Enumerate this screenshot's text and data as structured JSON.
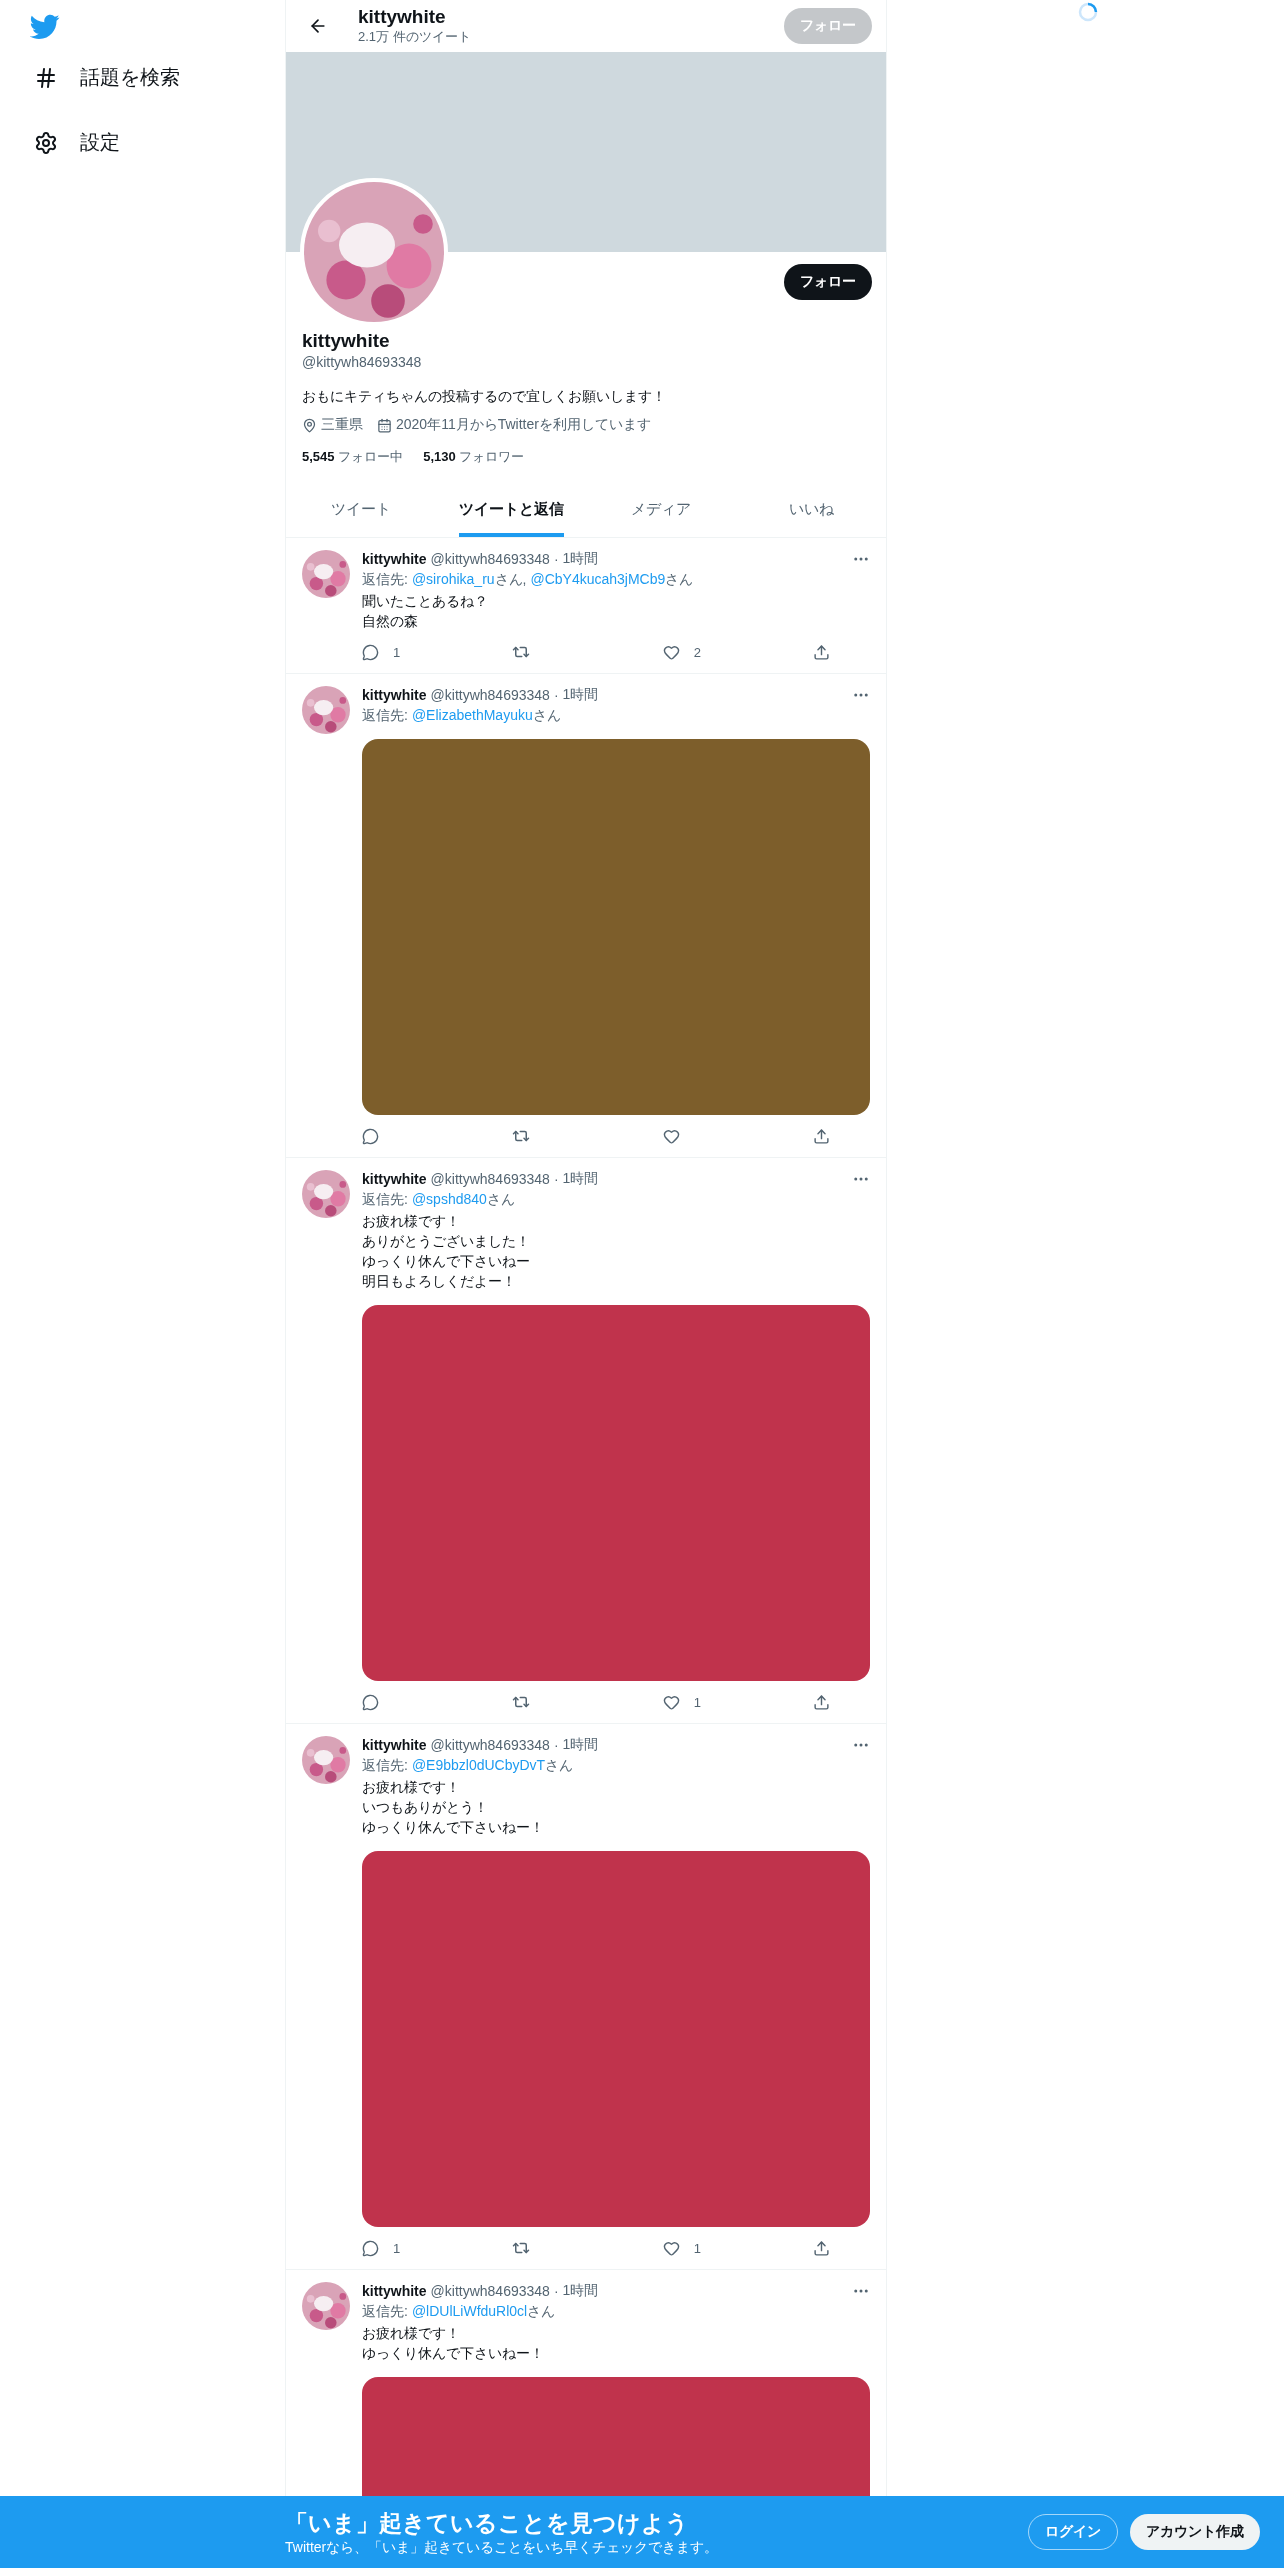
{
  "sidebar": {
    "items": [
      {
        "label": "話題を検索"
      },
      {
        "label": "設定"
      }
    ]
  },
  "header": {
    "name": "kittywhite",
    "tweet_count": "2.1万 件のツイート",
    "follow_button": {
      "label": "フォロー",
      "disabled": true
    }
  },
  "profile": {
    "follow_button": {
      "label": "フォロー",
      "disabled": false
    },
    "name": "kittywhite",
    "handle": "@kittywh84693348",
    "bio": "おもにキティちゃんの投稿するので宜しくお願いします！",
    "location": "三重県",
    "joined": "2020年11月からTwitterを利用しています",
    "following_count": "5,545",
    "following_label": "フォロー中",
    "followers_count": "5,130",
    "followers_label": "フォロワー"
  },
  "tabs": [
    {
      "label": "ツイート",
      "selected": false
    },
    {
      "label": "ツイートと返信",
      "selected": true
    },
    {
      "label": "メディア",
      "selected": false
    },
    {
      "label": "いいね",
      "selected": false
    }
  ],
  "tweets": [
    {
      "name": "kittywhite",
      "handle": "@kittywh84693348",
      "time": "1時間",
      "reply_label": "返信先:",
      "separator": "·",
      "reply_to": [
        {
          "mention": "@sirohika_ru",
          "suffix": "さん,"
        },
        {
          "mention": "@CbY4kucah3jMCb9",
          "suffix": "さん"
        }
      ],
      "lines": [
        "聞いたことあるね？",
        "自然の森"
      ],
      "replies": "1",
      "likes": "2"
    },
    {
      "name": "kittywhite",
      "handle": "@kittywh84693348",
      "time": "1時間",
      "reply_label": "返信先:",
      "separator": "·",
      "reply_to": [
        {
          "mention": "@ElizabethMayuku",
          "suffix": "さん"
        }
      ],
      "media": {
        "kind": "picture",
        "color": "#7d5e2b",
        "cut": false
      }
    },
    {
      "name": "kittywhite",
      "handle": "@kittywh84693348",
      "time": "1時間",
      "reply_label": "返信先:",
      "separator": "·",
      "reply_to": [
        {
          "mention": "@spshd840",
          "suffix": "さん"
        }
      ],
      "lines": [
        "お疲れ様です！",
        "ありがとうございました！",
        "ゆっくり休んで下さいねー",
        "明日もよろしくだよー！"
      ],
      "media": {
        "kind": "picture",
        "color": "#c0334c",
        "cut": false
      },
      "likes": "1"
    },
    {
      "name": "kittywhite",
      "handle": "@kittywh84693348",
      "time": "1時間",
      "reply_label": "返信先:",
      "separator": "·",
      "reply_to": [
        {
          "mention": "@E9bbzl0dUCbyDvT",
          "suffix": "さん"
        }
      ],
      "lines": [
        "お疲れ様です！",
        "いつもありがとう！",
        "ゆっくり休んで下さいねー！"
      ],
      "media": {
        "kind": "picture",
        "color": "#c0334c",
        "cut": false
      },
      "replies": "1",
      "likes": "1"
    },
    {
      "name": "kittywhite",
      "handle": "@kittywh84693348",
      "time": "1時間",
      "reply_label": "返信先:",
      "separator": "·",
      "reply_to": [
        {
          "mention": "@lDUlLiWfduRl0cl",
          "suffix": "さん"
        }
      ],
      "lines": [
        "お疲れ様です！",
        "ゆっくり休んで下さいねー！"
      ],
      "media": {
        "kind": "picture",
        "color": "#c0334c",
        "cut": true
      }
    }
  ],
  "bottom_bar": {
    "title": "「いま」起きていることを見つけよう",
    "subtitle": "Twitterなら、「いま」起きていることをいち早くチェックできます。",
    "login": "ログイン",
    "signup": "アカウント作成"
  }
}
